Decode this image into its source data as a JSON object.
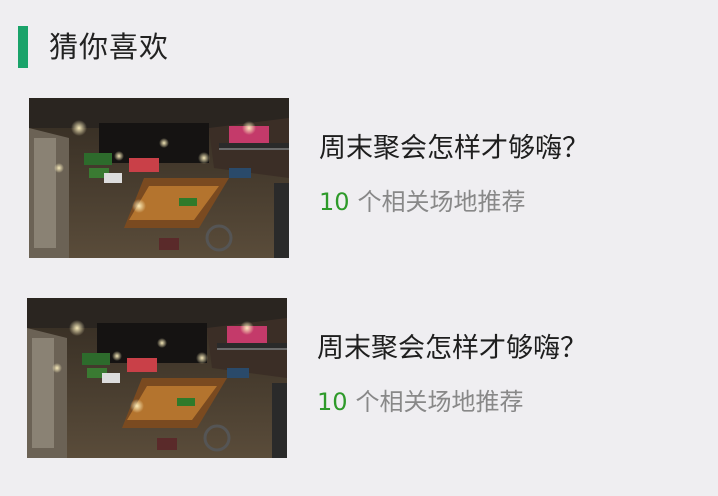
{
  "section": {
    "title": "猜你喜欢"
  },
  "colors": {
    "accent": "#1aa36a",
    "count": "#2e9a2a",
    "subtitle": "#888888",
    "background": "#efeef1"
  },
  "recommendations": [
    {
      "title": "周末聚会怎样才够嗨？",
      "count": "10",
      "suffix": "个相关场地推荐",
      "image": "bar-interior-photo"
    },
    {
      "title": "周末聚会怎样才够嗨？",
      "count": "10",
      "suffix": "个相关场地推荐",
      "image": "bar-interior-photo"
    }
  ]
}
